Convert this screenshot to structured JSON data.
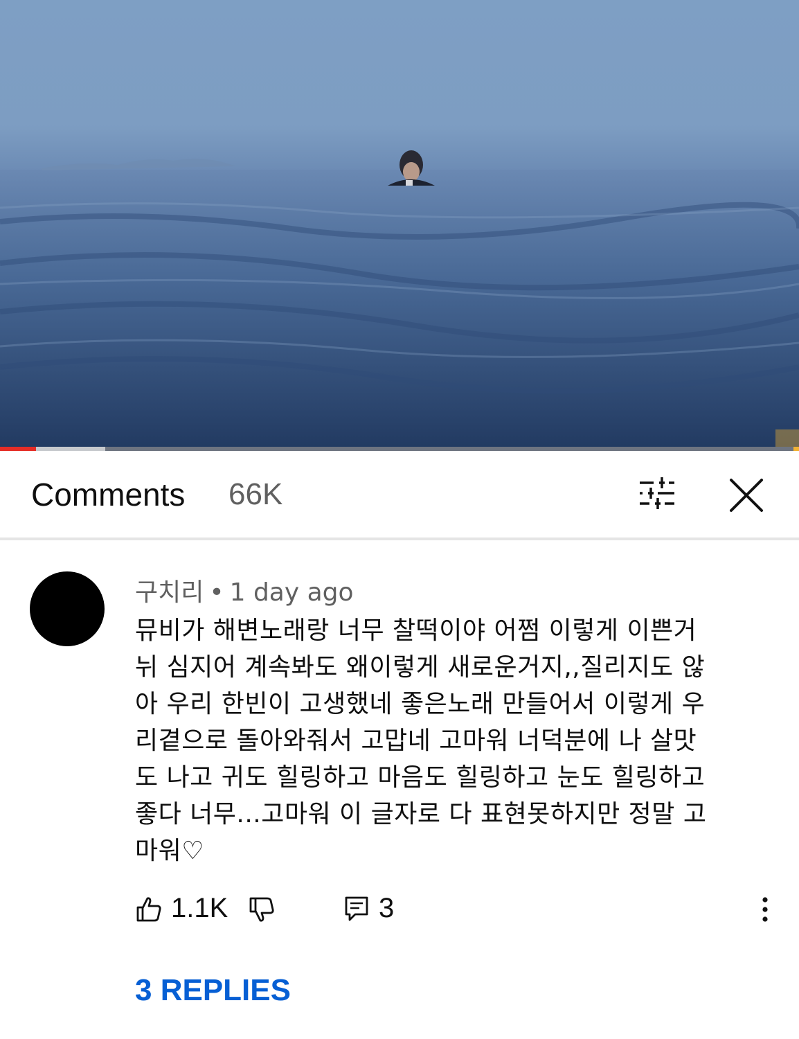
{
  "video": {
    "progress": {
      "played_fraction": 0.045,
      "buffered_fraction": 0.132
    }
  },
  "header": {
    "title": "Comments",
    "count": "66K"
  },
  "comment": {
    "author": "구치리",
    "separator": "•",
    "time": "1 day ago",
    "text_lines": [
      "뮤비가 해변노래랑 너무 찰떡이야 어쩜 이렇게 이쁜거",
      "뉘 심지어 계속봐도 왜이렇게 새로운거지,,질리지도 않",
      "아 우리 한빈이 고생했네 좋은노래 만들어서 이렇게 우",
      "리곁으로 돌아와줘서 고맙네 고마워 너덕분에 나 살맛",
      "도 나고 귀도 힐링하고 마음도 힐링하고 눈도 힐링하고",
      "좋다 너무...고마워 이 글자로 다 표현못하지만 정말 고",
      "마워♡"
    ],
    "likes": "1.1K",
    "reply_count": "3",
    "replies_link": "3 REPLIES"
  },
  "icons": {
    "filter": "sliders-icon",
    "close": "close-icon",
    "like": "thumbs-up-icon",
    "dislike": "thumbs-down-icon",
    "reply": "comment-icon",
    "more": "more-vert-icon"
  },
  "colors": {
    "link": "#065fd4",
    "progress_played": "#e52d27"
  }
}
